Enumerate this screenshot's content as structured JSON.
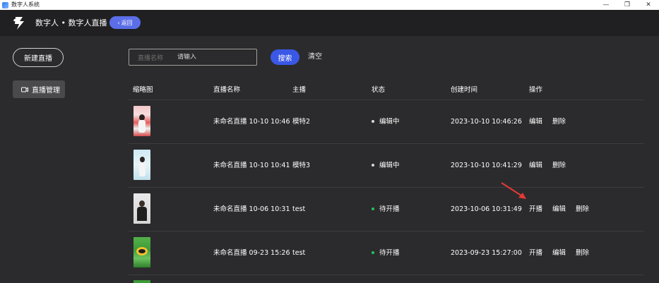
{
  "window": {
    "title": "数字人系统",
    "minimize": "—",
    "maximize": "❐",
    "close": "✕"
  },
  "header": {
    "app_name": "数字人 • 数字人直播",
    "back_label": "返回",
    "back_icon": "‹"
  },
  "sidebar": {
    "new_button": "新建直播",
    "items": [
      {
        "label": "直播管理",
        "icon": "video-camera-icon"
      }
    ]
  },
  "search": {
    "label": "直播名称",
    "placeholder": "请输入",
    "value": "",
    "search_button": "搜索",
    "clear_button": "清空"
  },
  "table": {
    "headers": [
      "缩略图",
      "直播名称",
      "主播",
      "状态",
      "创建时间",
      "操作"
    ],
    "rows": [
      {
        "name": "未命名直播 10-10 10:46",
        "anchor": "模特2",
        "status": "编辑中",
        "status_color": "#d9d9d9",
        "created": "2023-10-10 10:46:26",
        "actions": [
          "编辑",
          "删除"
        ]
      },
      {
        "name": "未命名直播 10-10 10:41",
        "anchor": "模特3",
        "status": "编辑中",
        "status_color": "#d9d9d9",
        "created": "2023-10-10 10:41:29",
        "actions": [
          "编辑",
          "删除"
        ]
      },
      {
        "name": "未命名直播 10-06 10:31",
        "anchor": "test",
        "status": "待开播",
        "status_color": "#22c55e",
        "created": "2023-10-06 10:31:49",
        "actions": [
          "开播",
          "编辑",
          "删除"
        ]
      },
      {
        "name": "未命名直播 09-23 15:26",
        "anchor": "test",
        "status": "待开播",
        "status_color": "#22c55e",
        "created": "2023-09-23 15:27:00",
        "actions": [
          "开播",
          "编辑",
          "删除"
        ]
      }
    ]
  },
  "colors": {
    "background": "#2b2b2d",
    "header": "#202022",
    "accent": "#3a57e6",
    "back_button": "#5b6ee8",
    "annotation_arrow": "#e53935"
  }
}
